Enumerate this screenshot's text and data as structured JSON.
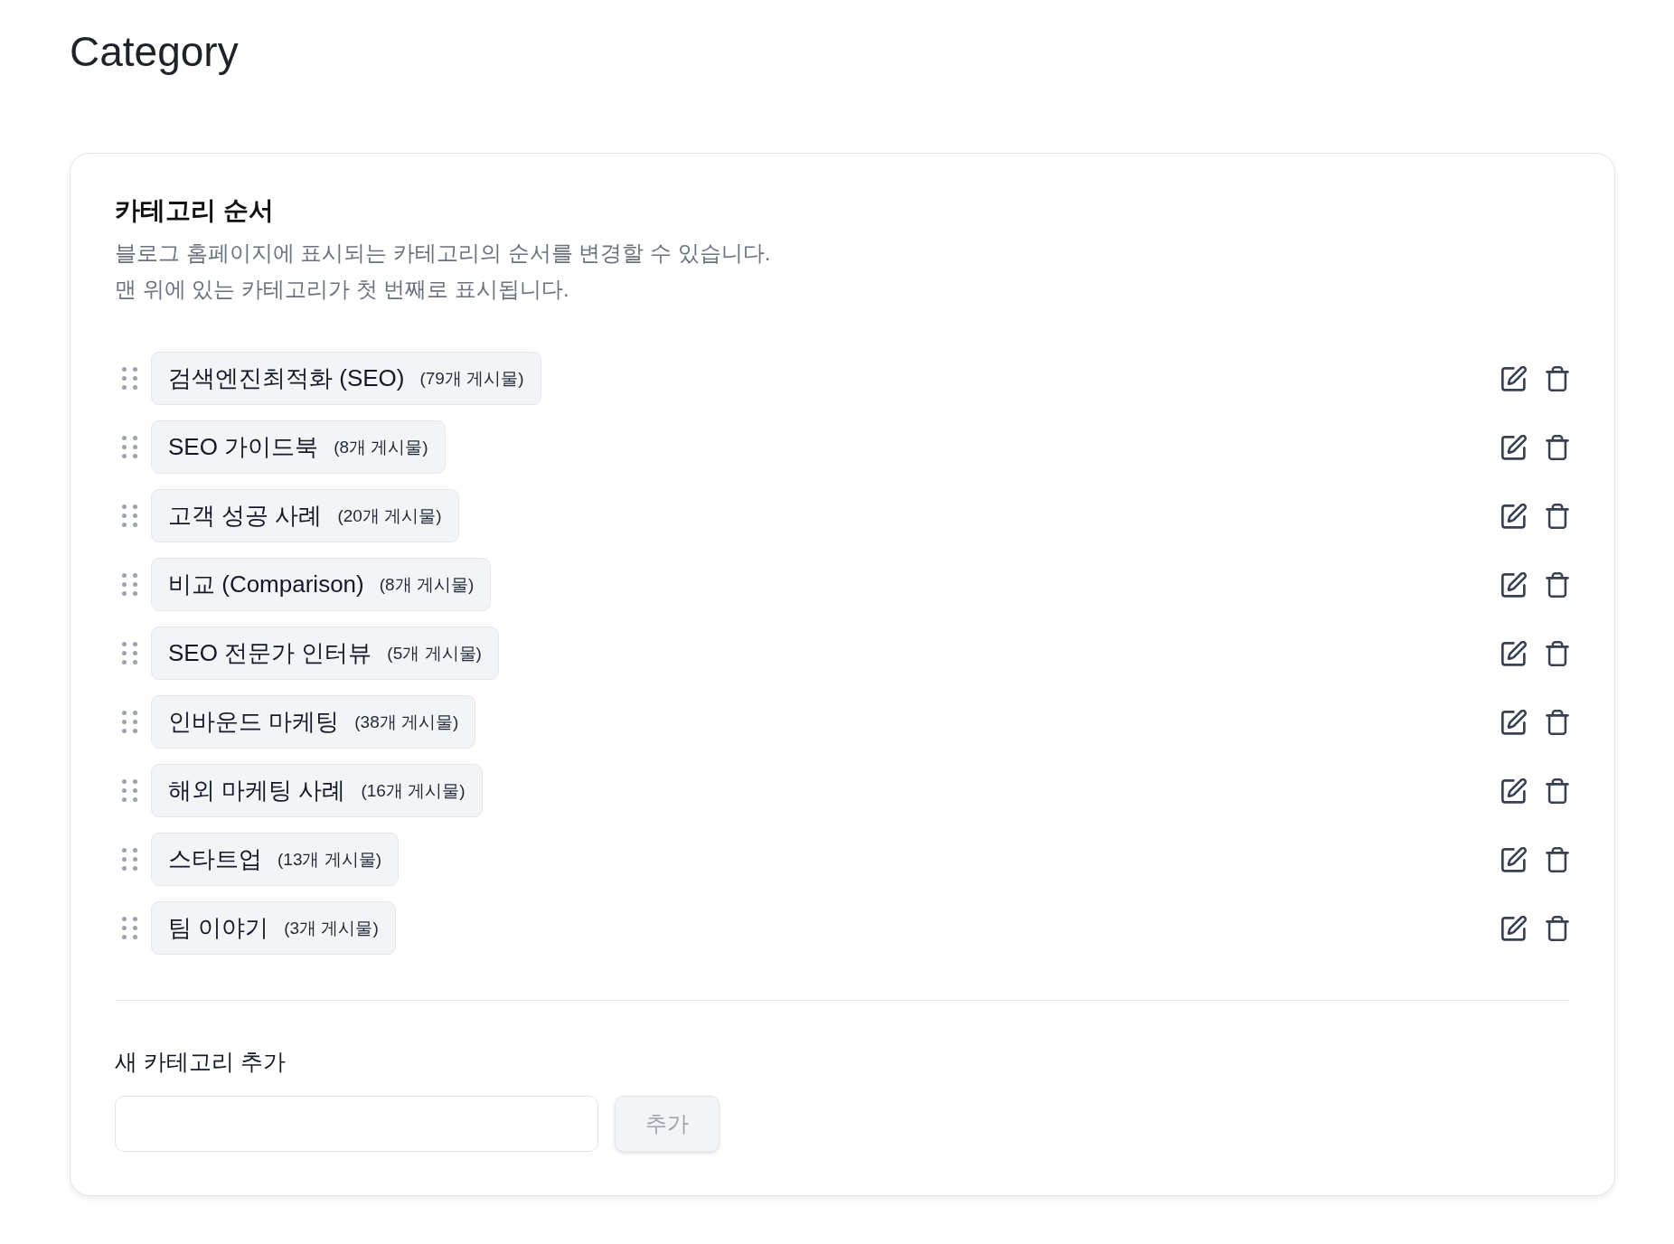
{
  "page": {
    "title": "Category"
  },
  "order_section": {
    "heading": "카테고리 순서",
    "description": [
      "블로그 홈페이지에 표시되는 카테고리의 순서를 변경할 수 있습니다.",
      "맨 위에 있는 카테고리가 첫 번째로 표시됩니다."
    ],
    "categories": [
      {
        "name": "검색엔진최적화 (SEO)",
        "count": "(79개 게시물)"
      },
      {
        "name": "SEO 가이드북",
        "count": "(8개 게시물)"
      },
      {
        "name": "고객 성공 사례",
        "count": "(20개 게시물)"
      },
      {
        "name": "비교 (Comparison)",
        "count": "(8개 게시물)"
      },
      {
        "name": "SEO 전문가 인터뷰",
        "count": "(5개 게시물)"
      },
      {
        "name": "인바운드 마케팅",
        "count": "(38개 게시물)"
      },
      {
        "name": "해외 마케팅 사례",
        "count": "(16개 게시물)"
      },
      {
        "name": "스타트업",
        "count": "(13개 게시물)"
      },
      {
        "name": "팀 이야기",
        "count": "(3개 게시물)"
      }
    ]
  },
  "add_section": {
    "label": "새 카테고리 추가",
    "button": {
      "label": "추가",
      "disabled": true
    }
  }
}
